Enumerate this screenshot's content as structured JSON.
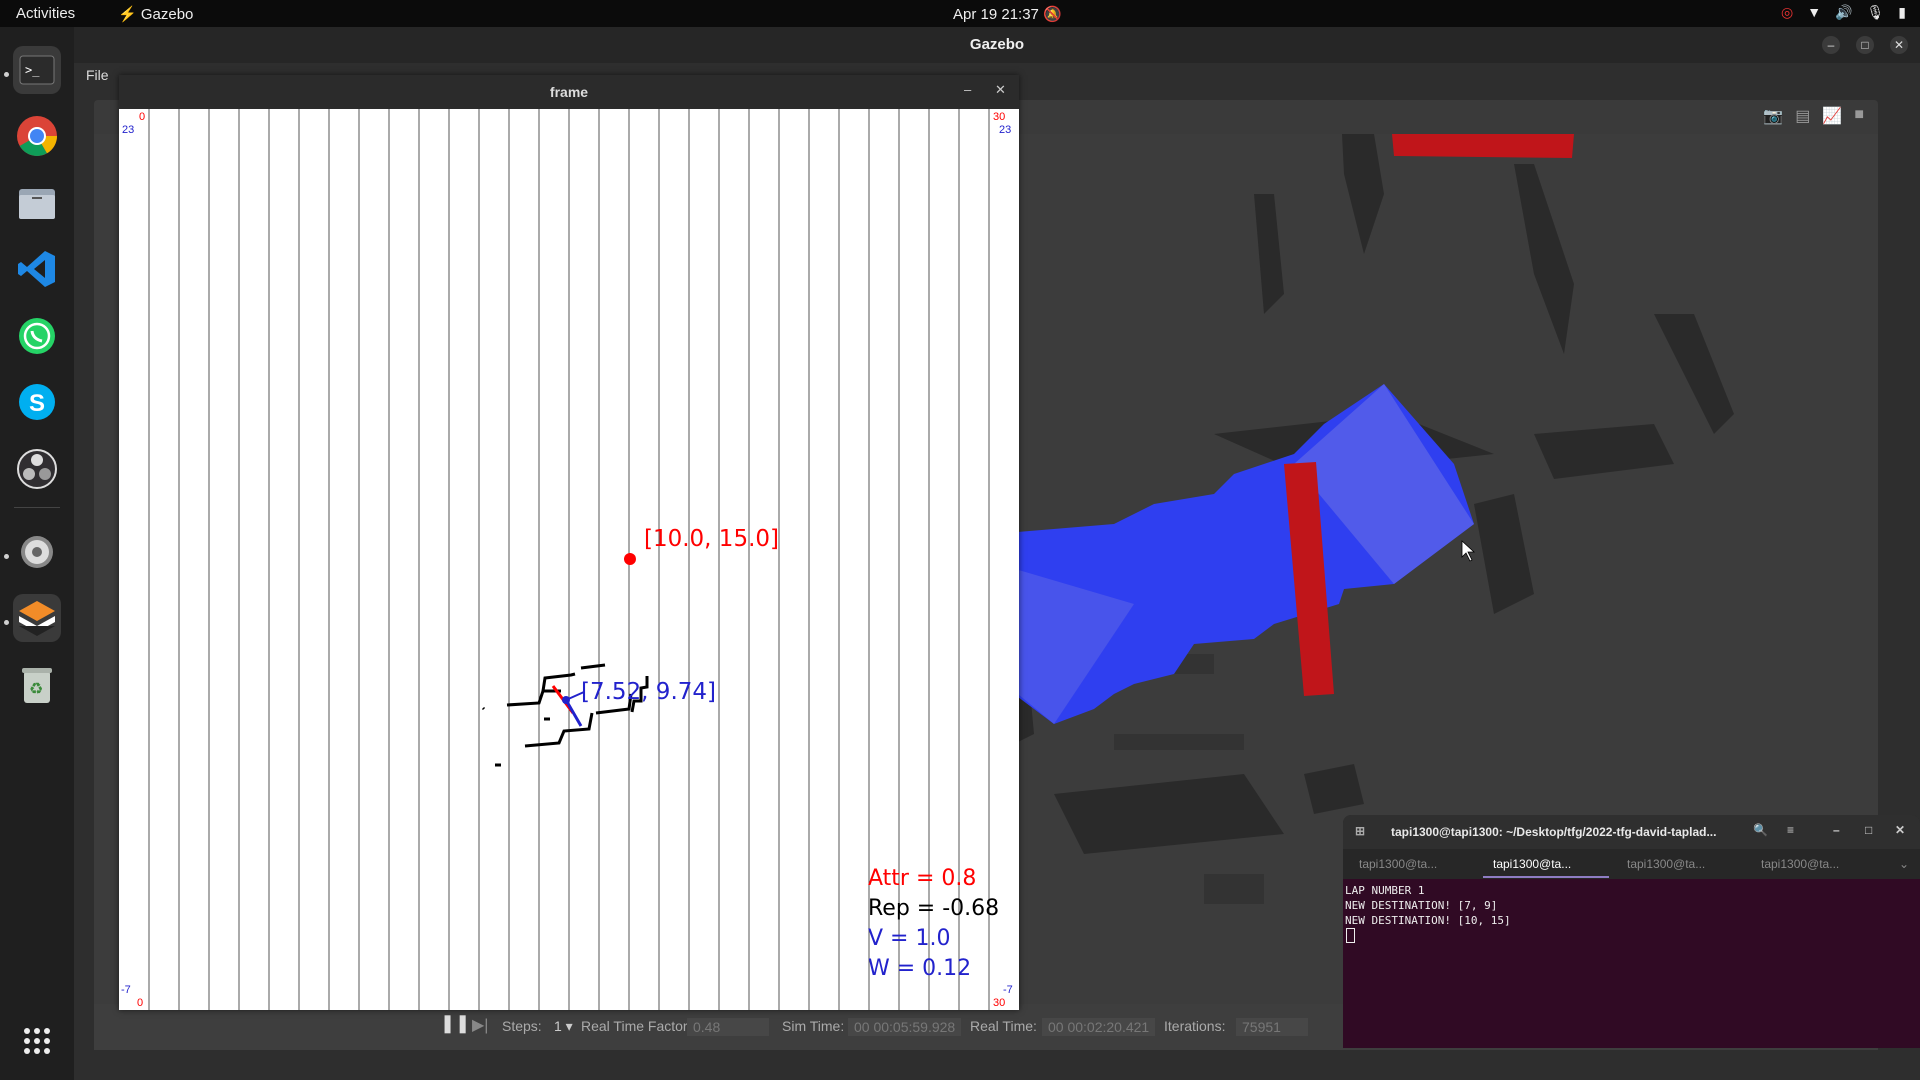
{
  "topbar": {
    "activities": "Activities",
    "app_name": "Gazebo",
    "clock": "Apr 19  21:37"
  },
  "gazebo": {
    "title": "Gazebo",
    "menu_file": "File",
    "bottom": {
      "steps_label": "Steps:",
      "steps_value": "1",
      "rtf_label": "Real Time Factor:",
      "rtf_value": "0.48",
      "sim_time_label": "Sim Time:",
      "sim_time_value": "00 00:05:59.928",
      "real_time_label": "Real Time:",
      "real_time_value": "00 00:02:20.421",
      "iterations_label": "Iterations:",
      "iterations_value": "75951"
    }
  },
  "frame": {
    "title": "frame",
    "corner_labels": {
      "tl_top": "0",
      "tl_bottom": "23",
      "tr_top": "30",
      "tr_bottom": "23",
      "bl_top": "-7",
      "bl_bottom": "0",
      "br_top": "-7",
      "br_bottom": "30"
    },
    "target_label": "[10.0, 15.0]",
    "robot_label": "[7.52, 9.74]",
    "readouts": {
      "attr": "Attr = 0.8",
      "rep": "Rep = -0.68",
      "v": "V = 1.0",
      "w": "W = 0.12"
    },
    "colors": {
      "target": "#ff0000",
      "robot": "#2222cc",
      "readout_red": "#ff0000",
      "readout_black": "#000000",
      "readout_blue": "#2222cc"
    }
  },
  "terminal": {
    "title": "tapi1300@tapi1300: ~/Desktop/tfg/2022-tfg-david-taplad...",
    "tabs": [
      "tapi1300@ta...",
      "tapi1300@ta...",
      "tapi1300@ta...",
      "tapi1300@ta..."
    ],
    "active_tab": 1,
    "lines": [
      "LAP NUMBER 1",
      "NEW DESTINATION! [7, 9]",
      "NEW DESTINATION! [10, 15]"
    ]
  }
}
